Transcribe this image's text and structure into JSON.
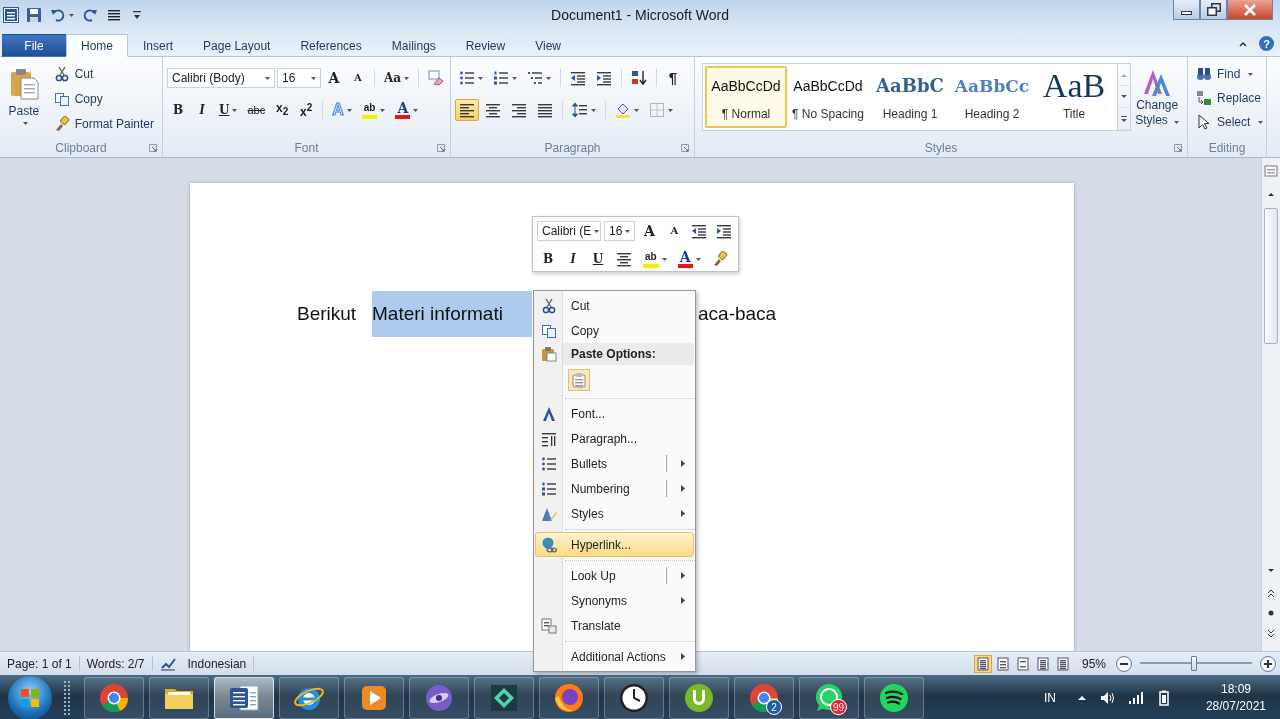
{
  "window": {
    "title": "Document1 - Microsoft Word"
  },
  "tabs": [
    {
      "label": "File",
      "kind": "file",
      "selected": false
    },
    {
      "label": "Home",
      "kind": "tab",
      "selected": true
    },
    {
      "label": "Insert",
      "kind": "tab",
      "selected": false
    },
    {
      "label": "Page Layout",
      "kind": "tab",
      "selected": false
    },
    {
      "label": "References",
      "kind": "tab",
      "selected": false
    },
    {
      "label": "Mailings",
      "kind": "tab",
      "selected": false
    },
    {
      "label": "Review",
      "kind": "tab",
      "selected": false
    },
    {
      "label": "View",
      "kind": "tab",
      "selected": false
    }
  ],
  "help": "?",
  "ribbon": {
    "clipboard": {
      "label": "Clipboard",
      "paste": "Paste",
      "commands": [
        {
          "label": "Cut",
          "kind": "cut"
        },
        {
          "label": "Copy",
          "kind": "copy"
        },
        {
          "label": "Format Painter",
          "kind": "format-painter"
        }
      ]
    },
    "font": {
      "label": "Font",
      "font_name": "Calibri (Body)",
      "font_size": "16",
      "row1": [
        {
          "kind": "grow-font",
          "glyph": "A",
          "dropdown": false,
          "selected": false
        },
        {
          "kind": "shrink-font",
          "glyph": "A",
          "dropdown": false,
          "selected": false
        },
        {
          "kind": "change-case",
          "glyph": "Aa",
          "dropdown": true,
          "selected": false
        },
        {
          "kind": "clear-formatting",
          "dropdown": false,
          "selected": false
        }
      ],
      "row2": [
        {
          "kind": "bold",
          "glyph": "B",
          "dropdown": false,
          "selected": false
        },
        {
          "kind": "italic",
          "glyph": "I",
          "dropdown": false,
          "selected": false
        },
        {
          "kind": "underline",
          "glyph": "U",
          "dropdown": true,
          "selected": false
        },
        {
          "kind": "strikethrough",
          "glyph": "abc",
          "dropdown": false,
          "selected": false
        },
        {
          "kind": "subscript",
          "glyph": "x$_{2}$",
          "dropdown": false,
          "selected": false
        },
        {
          "kind": "superscript",
          "glyph": "x$^{2}$",
          "dropdown": false,
          "selected": false
        },
        {
          "kind": "text-effects",
          "glyph": "A",
          "dropdown": true,
          "selected": false
        },
        {
          "kind": "highlight",
          "glyph": "ab",
          "dropdown": true,
          "selected": false
        },
        {
          "kind": "font-color",
          "glyph": "A",
          "dropdown": true,
          "selected": false
        }
      ]
    },
    "paragraph": {
      "label": "Paragraph",
      "row1": [
        {
          "kind": "bullets",
          "dropdown": true,
          "selected": false
        },
        {
          "kind": "numbering",
          "dropdown": true,
          "selected": false
        },
        {
          "kind": "multilevel-list",
          "dropdown": true,
          "selected": false
        },
        {
          "kind": "decrease-indent",
          "dropdown": false,
          "selected": false
        },
        {
          "kind": "increase-indent",
          "dropdown": false,
          "selected": false
        },
        {
          "kind": "sort",
          "dropdown": false,
          "selected": false
        },
        {
          "kind": "show-marks",
          "glyph": "¶",
          "dropdown": false,
          "selected": false
        }
      ],
      "row2": [
        {
          "kind": "align-left",
          "dropdown": false,
          "selected": true
        },
        {
          "kind": "align-center",
          "dropdown": false,
          "selected": false
        },
        {
          "kind": "align-right",
          "dropdown": false,
          "selected": false
        },
        {
          "kind": "justify",
          "dropdown": false,
          "selected": false
        },
        {
          "kind": "line-spacing",
          "dropdown": true,
          "selected": false
        },
        {
          "kind": "shading",
          "dropdown": true,
          "selected": false
        },
        {
          "kind": "borders",
          "dropdown": true,
          "selected": false
        }
      ]
    },
    "styles": {
      "label": "Styles",
      "change_styles": "Change Styles",
      "gallery": [
        {
          "preview": "AaBbCcDd",
          "label": "¶ Normal",
          "kind": "normal",
          "selected": true
        },
        {
          "preview": "AaBbCcDd",
          "label": "¶ No Spacing",
          "kind": "normal",
          "selected": false
        },
        {
          "preview": "AaBbC",
          "label": "Heading 1",
          "kind": "heading1",
          "selected": false
        },
        {
          "preview": "AaBbCc",
          "label": "Heading 2",
          "kind": "heading2",
          "selected": false
        },
        {
          "preview": "AaB",
          "label": "Title",
          "kind": "title",
          "selected": false
        }
      ]
    },
    "editing": {
      "label": "Editing",
      "commands": [
        {
          "label": "Find",
          "kind": "find",
          "dropdown": true
        },
        {
          "label": "Replace",
          "kind": "replace",
          "dropdown": false
        },
        {
          "label": "Select",
          "kind": "select",
          "dropdown": true
        }
      ]
    }
  },
  "document": {
    "text_before": "Berikut",
    "selected_text": "Materi informati",
    "text_after": "aca-baca"
  },
  "mini_toolbar": {
    "font_name": "Calibri (E",
    "font_size": "16",
    "row1": [
      {
        "kind": "grow-font",
        "glyph": "A",
        "dropdown": false,
        "selected": false
      },
      {
        "kind": "shrink-font",
        "glyph": "A",
        "dropdown": false,
        "selected": false
      },
      {
        "kind": "decrease-indent",
        "dropdown": false,
        "selected": false
      },
      {
        "kind": "increase-indent",
        "dropdown": false,
        "selected": false
      }
    ],
    "row2": [
      {
        "kind": "bold",
        "glyph": "B",
        "dropdown": false,
        "selected": false
      },
      {
        "kind": "italic",
        "glyph": "I",
        "dropdown": false,
        "selected": false
      },
      {
        "kind": "underline",
        "glyph": "U",
        "dropdown": false,
        "selected": false
      },
      {
        "kind": "align-center",
        "dropdown": false,
        "selected": false
      },
      {
        "kind": "highlight",
        "glyph": "ab",
        "dropdown": true,
        "selected": false
      },
      {
        "kind": "font-color",
        "glyph": "A",
        "dropdown": true,
        "selected": false
      },
      {
        "kind": "format-painter",
        "dropdown": false,
        "selected": false
      }
    ]
  },
  "context_menu": [
    {
      "kind": "cut",
      "label": "Cut",
      "submenu": false,
      "split": false,
      "separator_before": false,
      "selected": false
    },
    {
      "kind": "copy",
      "label": "Copy",
      "submenu": false,
      "split": false,
      "separator_before": false,
      "selected": false
    },
    {
      "kind": "header",
      "label": "Paste Options:",
      "submenu": false,
      "split": false,
      "separator_before": false,
      "selected": false
    },
    {
      "kind": "paste",
      "submenu": false,
      "split": false,
      "separator_before": false,
      "selected": false
    },
    {
      "kind": "font",
      "label": "Font...",
      "submenu": false,
      "split": false,
      "separator_before": true,
      "selected": false
    },
    {
      "kind": "paragraph",
      "label": "Paragraph...",
      "submenu": false,
      "split": false,
      "separator_before": false,
      "selected": false
    },
    {
      "kind": "bullets",
      "label": "Bullets",
      "submenu": true,
      "split": true,
      "separator_before": false,
      "selected": false
    },
    {
      "kind": "numbering",
      "label": "Numbering",
      "submenu": true,
      "split": true,
      "separator_before": false,
      "selected": false
    },
    {
      "kind": "styles",
      "label": "Styles",
      "submenu": true,
      "split": false,
      "separator_before": false,
      "selected": false
    },
    {
      "kind": "hyperlink",
      "label": "Hyperlink...",
      "submenu": false,
      "split": false,
      "separator_before": true,
      "selected": true
    },
    {
      "kind": "text",
      "label": "Look Up",
      "submenu": true,
      "split": true,
      "separator_before": true,
      "selected": false
    },
    {
      "kind": "text",
      "label": "Synonyms",
      "submenu": true,
      "split": false,
      "separator_before": false,
      "selected": false
    },
    {
      "kind": "translate",
      "label": "Translate",
      "submenu": false,
      "split": false,
      "separator_before": false,
      "selected": false
    },
    {
      "kind": "text",
      "label": "Additional Actions",
      "submenu": true,
      "split": false,
      "separator_before": true,
      "selected": false
    }
  ],
  "status_bar": {
    "page": "Page: 1 of 1",
    "words": "Words: 2/7",
    "language": "Indonesian",
    "views": [
      {
        "kind": "print",
        "selected": true
      },
      {
        "kind": "reading",
        "selected": false
      },
      {
        "kind": "web",
        "selected": false
      },
      {
        "kind": "outline",
        "selected": false
      },
      {
        "kind": "draft",
        "selected": false
      }
    ],
    "zoom": "95%",
    "zoom_slider": {
      "level": 0.48
    }
  },
  "taskbar": {
    "apps": [
      {
        "kind": "browser",
        "selected": false
      },
      {
        "kind": "folder",
        "selected": false
      },
      {
        "kind": "document",
        "selected": true
      },
      {
        "kind": "globe",
        "selected": false
      },
      {
        "kind": "play",
        "selected": false
      },
      {
        "kind": "swirl",
        "selected": false
      },
      {
        "kind": "diamond",
        "selected": false
      },
      {
        "kind": "fox",
        "selected": false
      },
      {
        "kind": "clock",
        "selected": false
      },
      {
        "kind": "torrent",
        "selected": false
      },
      {
        "kind": "browser",
        "selected": false,
        "badge": {
          "text": "2",
          "color": "#1f5fa8"
        }
      },
      {
        "kind": "chat",
        "selected": false,
        "badge": {
          "text": "99",
          "color": "#e0262b"
        }
      },
      {
        "kind": "music",
        "selected": false
      }
    ],
    "language": "IN",
    "time": "18:09",
    "date": "28/07/2021"
  }
}
